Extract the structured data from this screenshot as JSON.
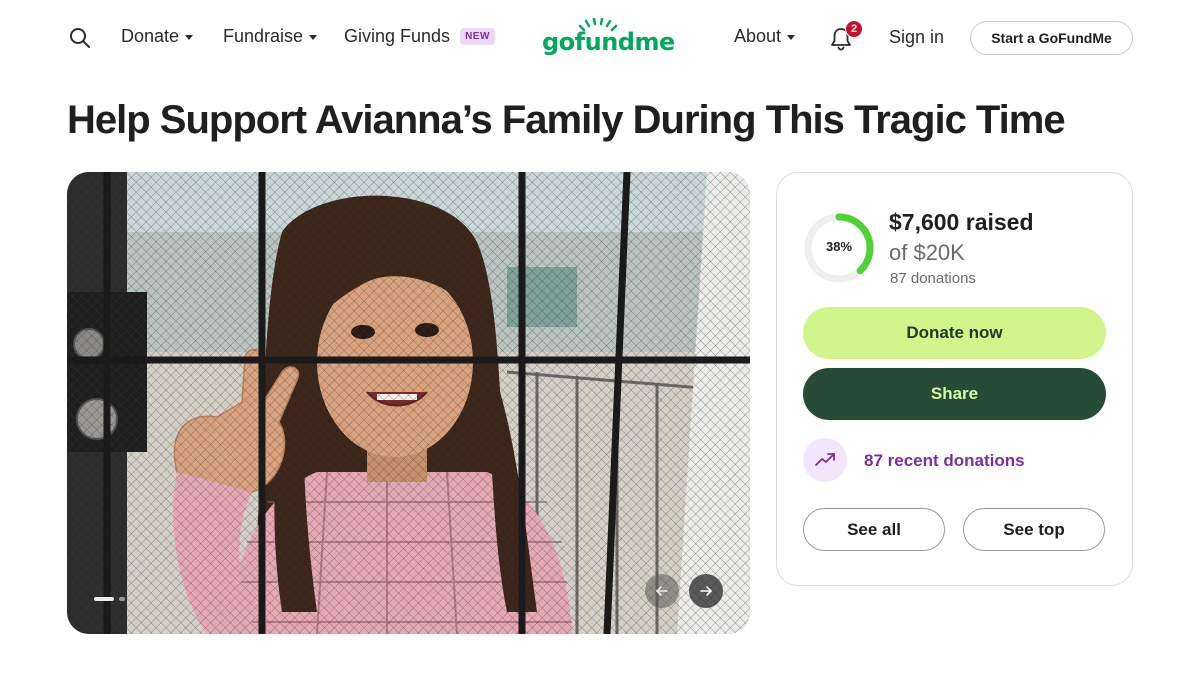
{
  "header": {
    "nav": {
      "donate": "Donate",
      "fundraise": "Fundraise",
      "giving_funds": "Giving Funds",
      "giving_funds_badge": "NEW",
      "about": "About"
    },
    "logo_text": "gofundme",
    "notification_count": "2",
    "sign_in": "Sign in",
    "start_button": "Start a GoFundMe"
  },
  "campaign": {
    "title": "Help Support Avianna’s Family During This Tragic Time",
    "progress_label": "38%",
    "progress_fraction": 0.38,
    "raised": "$7,600 raised",
    "goal": "of $20K",
    "donations": "87 donations",
    "donate_button": "Donate now",
    "share_button": "Share",
    "recent_donations": "87 recent donations",
    "see_all_button": "See all",
    "see_top_button": "See top"
  },
  "colors": {
    "brand_green": "#02a95c",
    "donate_bg": "#d1f58a",
    "share_bg": "#274c36",
    "accent_purple": "#7a2ea3",
    "progress_green": "#4cd137",
    "notification_red": "#c8102e"
  },
  "icons": {
    "search": "search-icon",
    "bell": "bell-icon",
    "trend": "trending-up-icon",
    "prev": "arrow-left-icon",
    "next": "arrow-right-icon"
  }
}
